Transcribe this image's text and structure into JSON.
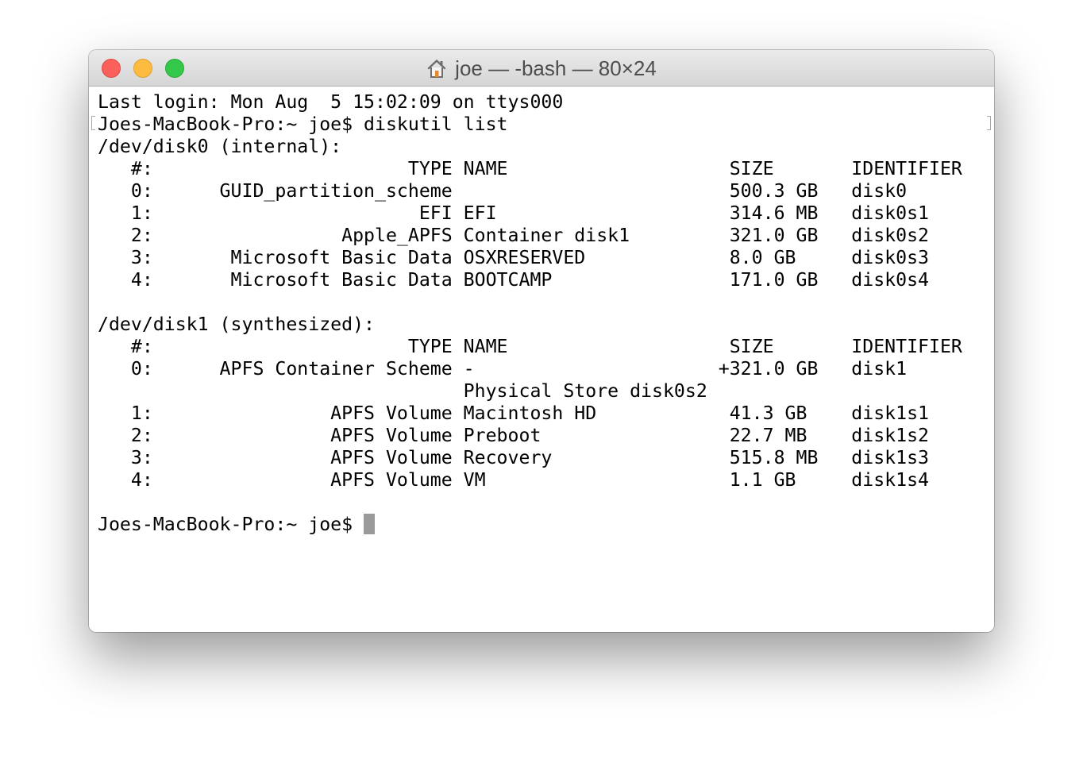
{
  "window": {
    "title": "joe — -bash — 80×24",
    "title_icon": "home-icon"
  },
  "terminal": {
    "lines": [
      "Last login: Mon Aug  5 15:02:09 on ttys000",
      "Joes-MacBook-Pro:~ joe$ diskutil list",
      "/dev/disk0 (internal):",
      "   #:                       TYPE NAME                    SIZE       IDENTIFIER",
      "   0:      GUID_partition_scheme                         500.3 GB   disk0",
      "   1:                        EFI EFI                     314.6 MB   disk0s1",
      "   2:                 Apple_APFS Container disk1         321.0 GB   disk0s2",
      "   3:       Microsoft Basic Data OSXRESERVED             8.0 GB     disk0s3",
      "   4:       Microsoft Basic Data BOOTCAMP                171.0 GB   disk0s4",
      "",
      "/dev/disk1 (synthesized):",
      "   #:                       TYPE NAME                    SIZE       IDENTIFIER",
      "   0:      APFS Container Scheme -                      +321.0 GB   disk1",
      "                                 Physical Store disk0s2",
      "   1:                APFS Volume Macintosh HD            41.3 GB    disk1s1",
      "   2:                APFS Volume Preboot                 22.7 MB    disk1s2",
      "   3:                APFS Volume Recovery                515.8 MB   disk1s3",
      "   4:                APFS Volume VM                      1.1 GB     disk1s4",
      "",
      "Joes-MacBook-Pro:~ joe$ "
    ]
  },
  "colors": {
    "close": "#fc605b",
    "minimize": "#fdbc40",
    "zoom": "#34c84a",
    "cursor": "#9a9a9a"
  }
}
